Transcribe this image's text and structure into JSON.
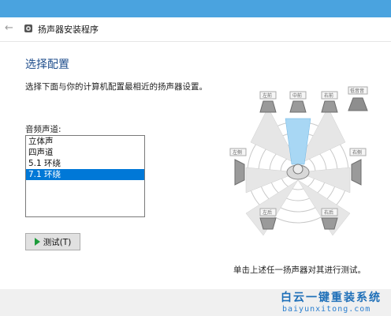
{
  "window": {
    "title": "扬声器安装程序"
  },
  "heading": "选择配置",
  "description": "选择下面与你的计算机配置最相近的扬声器设置。",
  "channels": {
    "label": "音频声道:",
    "items": [
      "立体声",
      "四声道",
      "5.1 环绕",
      "7.1 环绕"
    ],
    "selected": "7.1 环绕"
  },
  "test_button": {
    "label": "测试(T)"
  },
  "hint": "单击上述任一扬声器对其进行测试。",
  "speakers": {
    "front_left": "左前",
    "center": "中前",
    "front_right": "右前",
    "subwoofer": "低音音",
    "side_left": "左侧",
    "side_right": "右侧",
    "rear_left": "左后",
    "rear_right": "右后"
  },
  "watermark": {
    "chinese": "白云一键重装系统",
    "url": "baiyunxitong.com"
  },
  "colors": {
    "accent": "#0078d7",
    "heading": "#1f4e8c",
    "test_icon": "#1c9b3a"
  }
}
